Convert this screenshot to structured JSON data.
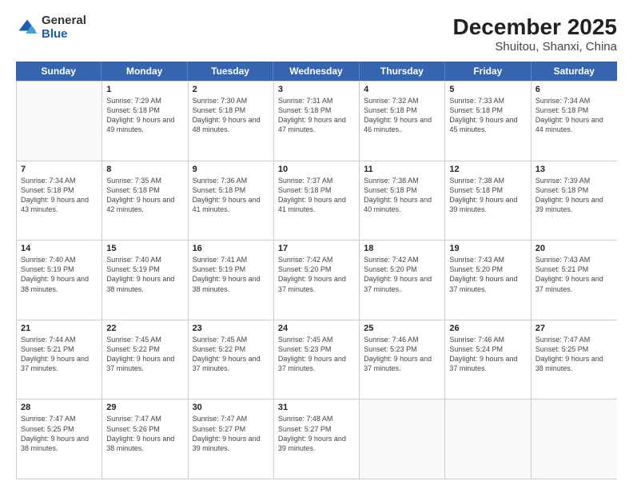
{
  "logo": {
    "general": "General",
    "blue": "Blue"
  },
  "title": "December 2025",
  "subtitle": "Shuitou, Shanxi, China",
  "days": [
    "Sunday",
    "Monday",
    "Tuesday",
    "Wednesday",
    "Thursday",
    "Friday",
    "Saturday"
  ],
  "weeks": [
    [
      {
        "num": "",
        "sunrise": "",
        "sunset": "",
        "daylight": "",
        "empty": true
      },
      {
        "num": "1",
        "sunrise": "Sunrise: 7:29 AM",
        "sunset": "Sunset: 5:18 PM",
        "daylight": "Daylight: 9 hours and 49 minutes."
      },
      {
        "num": "2",
        "sunrise": "Sunrise: 7:30 AM",
        "sunset": "Sunset: 5:18 PM",
        "daylight": "Daylight: 9 hours and 48 minutes."
      },
      {
        "num": "3",
        "sunrise": "Sunrise: 7:31 AM",
        "sunset": "Sunset: 5:18 PM",
        "daylight": "Daylight: 9 hours and 47 minutes."
      },
      {
        "num": "4",
        "sunrise": "Sunrise: 7:32 AM",
        "sunset": "Sunset: 5:18 PM",
        "daylight": "Daylight: 9 hours and 46 minutes."
      },
      {
        "num": "5",
        "sunrise": "Sunrise: 7:33 AM",
        "sunset": "Sunset: 5:18 PM",
        "daylight": "Daylight: 9 hours and 45 minutes."
      },
      {
        "num": "6",
        "sunrise": "Sunrise: 7:34 AM",
        "sunset": "Sunset: 5:18 PM",
        "daylight": "Daylight: 9 hours and 44 minutes."
      }
    ],
    [
      {
        "num": "7",
        "sunrise": "Sunrise: 7:34 AM",
        "sunset": "Sunset: 5:18 PM",
        "daylight": "Daylight: 9 hours and 43 minutes."
      },
      {
        "num": "8",
        "sunrise": "Sunrise: 7:35 AM",
        "sunset": "Sunset: 5:18 PM",
        "daylight": "Daylight: 9 hours and 42 minutes."
      },
      {
        "num": "9",
        "sunrise": "Sunrise: 7:36 AM",
        "sunset": "Sunset: 5:18 PM",
        "daylight": "Daylight: 9 hours and 41 minutes."
      },
      {
        "num": "10",
        "sunrise": "Sunrise: 7:37 AM",
        "sunset": "Sunset: 5:18 PM",
        "daylight": "Daylight: 9 hours and 41 minutes."
      },
      {
        "num": "11",
        "sunrise": "Sunrise: 7:38 AM",
        "sunset": "Sunset: 5:18 PM",
        "daylight": "Daylight: 9 hours and 40 minutes."
      },
      {
        "num": "12",
        "sunrise": "Sunrise: 7:38 AM",
        "sunset": "Sunset: 5:18 PM",
        "daylight": "Daylight: 9 hours and 39 minutes."
      },
      {
        "num": "13",
        "sunrise": "Sunrise: 7:39 AM",
        "sunset": "Sunset: 5:18 PM",
        "daylight": "Daylight: 9 hours and 39 minutes."
      }
    ],
    [
      {
        "num": "14",
        "sunrise": "Sunrise: 7:40 AM",
        "sunset": "Sunset: 5:19 PM",
        "daylight": "Daylight: 9 hours and 38 minutes."
      },
      {
        "num": "15",
        "sunrise": "Sunrise: 7:40 AM",
        "sunset": "Sunset: 5:19 PM",
        "daylight": "Daylight: 9 hours and 38 minutes."
      },
      {
        "num": "16",
        "sunrise": "Sunrise: 7:41 AM",
        "sunset": "Sunset: 5:19 PM",
        "daylight": "Daylight: 9 hours and 38 minutes."
      },
      {
        "num": "17",
        "sunrise": "Sunrise: 7:42 AM",
        "sunset": "Sunset: 5:20 PM",
        "daylight": "Daylight: 9 hours and 37 minutes."
      },
      {
        "num": "18",
        "sunrise": "Sunrise: 7:42 AM",
        "sunset": "Sunset: 5:20 PM",
        "daylight": "Daylight: 9 hours and 37 minutes."
      },
      {
        "num": "19",
        "sunrise": "Sunrise: 7:43 AM",
        "sunset": "Sunset: 5:20 PM",
        "daylight": "Daylight: 9 hours and 37 minutes."
      },
      {
        "num": "20",
        "sunrise": "Sunrise: 7:43 AM",
        "sunset": "Sunset: 5:21 PM",
        "daylight": "Daylight: 9 hours and 37 minutes."
      }
    ],
    [
      {
        "num": "21",
        "sunrise": "Sunrise: 7:44 AM",
        "sunset": "Sunset: 5:21 PM",
        "daylight": "Daylight: 9 hours and 37 minutes."
      },
      {
        "num": "22",
        "sunrise": "Sunrise: 7:45 AM",
        "sunset": "Sunset: 5:22 PM",
        "daylight": "Daylight: 9 hours and 37 minutes."
      },
      {
        "num": "23",
        "sunrise": "Sunrise: 7:45 AM",
        "sunset": "Sunset: 5:22 PM",
        "daylight": "Daylight: 9 hours and 37 minutes."
      },
      {
        "num": "24",
        "sunrise": "Sunrise: 7:45 AM",
        "sunset": "Sunset: 5:23 PM",
        "daylight": "Daylight: 9 hours and 37 minutes."
      },
      {
        "num": "25",
        "sunrise": "Sunrise: 7:46 AM",
        "sunset": "Sunset: 5:23 PM",
        "daylight": "Daylight: 9 hours and 37 minutes."
      },
      {
        "num": "26",
        "sunrise": "Sunrise: 7:46 AM",
        "sunset": "Sunset: 5:24 PM",
        "daylight": "Daylight: 9 hours and 37 minutes."
      },
      {
        "num": "27",
        "sunrise": "Sunrise: 7:47 AM",
        "sunset": "Sunset: 5:25 PM",
        "daylight": "Daylight: 9 hours and 38 minutes."
      }
    ],
    [
      {
        "num": "28",
        "sunrise": "Sunrise: 7:47 AM",
        "sunset": "Sunset: 5:25 PM",
        "daylight": "Daylight: 9 hours and 38 minutes."
      },
      {
        "num": "29",
        "sunrise": "Sunrise: 7:47 AM",
        "sunset": "Sunset: 5:26 PM",
        "daylight": "Daylight: 9 hours and 38 minutes."
      },
      {
        "num": "30",
        "sunrise": "Sunrise: 7:47 AM",
        "sunset": "Sunset: 5:27 PM",
        "daylight": "Daylight: 9 hours and 39 minutes."
      },
      {
        "num": "31",
        "sunrise": "Sunrise: 7:48 AM",
        "sunset": "Sunset: 5:27 PM",
        "daylight": "Daylight: 9 hours and 39 minutes."
      },
      {
        "num": "",
        "sunrise": "",
        "sunset": "",
        "daylight": "",
        "empty": true
      },
      {
        "num": "",
        "sunrise": "",
        "sunset": "",
        "daylight": "",
        "empty": true
      },
      {
        "num": "",
        "sunrise": "",
        "sunset": "",
        "daylight": "",
        "empty": true
      }
    ]
  ]
}
